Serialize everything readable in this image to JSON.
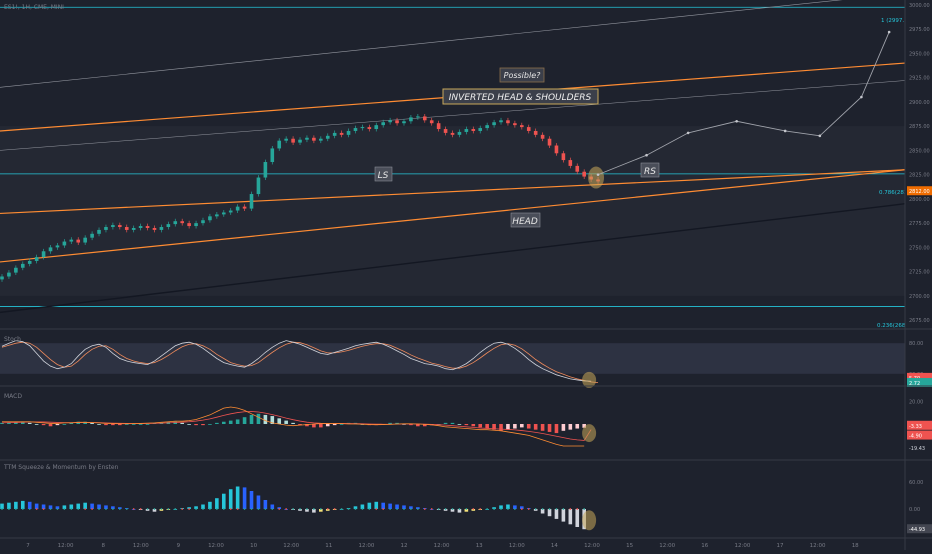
{
  "header": {
    "symbol_line": "ES1!, 1H, CME, MINI"
  },
  "panes": {
    "stoch_title": "Stoch",
    "macd_title": "MACD",
    "ttm_title": "TTM Squeeze & Momentum by Ensten"
  },
  "annotations": {
    "possible": "Possible?",
    "pattern": "INVERTED HEAD & SHOULDERS",
    "ls": "LS",
    "head": "HEAD",
    "rs": "RS"
  },
  "levels": {
    "top_label": "1 (2997.50)",
    "fib_label": "0.786(2825.75)",
    "bottom_label": "0.236(2689.00)"
  },
  "axis": {
    "price_ticks": [
      "3000.00",
      "2975.00",
      "2950.00",
      "2925.00",
      "2900.00",
      "2875.00",
      "2850.00",
      "2825.00",
      "2800.00",
      "2775.00",
      "2750.00",
      "2725.00",
      "2700.00",
      "2675.00"
    ],
    "current_price": "2812.00",
    "stoch_ticks": [
      "80.00",
      "20.00"
    ],
    "stoch_values": [
      "5.70",
      "2.72"
    ],
    "macd_ticks": [
      "20.00",
      "0.00"
    ],
    "macd_values": [
      "-3.33",
      "-4.90",
      "-19.43"
    ],
    "ttm_ticks": [
      "60.00",
      "0.00"
    ],
    "ttm_value": "-44.93",
    "time_labels": [
      "7",
      "12:00",
      "8",
      "12:00",
      "9",
      "12:00",
      "10",
      "12:00",
      "11",
      "12:00",
      "12",
      "12:00",
      "13",
      "12:00",
      "14",
      "12:00",
      "15",
      "12:00",
      "16",
      "12:00",
      "17",
      "12:00",
      "18"
    ]
  },
  "colors": {
    "background": "#1e222d",
    "band": "#2a2e39",
    "up": "#26a69a",
    "down": "#ef5350",
    "orange": "#ff8c33",
    "teal_line": "#26c6da",
    "highlight": "#c8a85a"
  },
  "chart_data": {
    "type": "candlestick",
    "price_series": {
      "name": "ES1!",
      "close": [
        2720,
        2724,
        2729,
        2733,
        2736,
        2740,
        2746,
        2750,
        2752,
        2756,
        2758,
        2755,
        2760,
        2764,
        2768,
        2771,
        2773,
        2771,
        2768,
        2770,
        2772,
        2770,
        2768,
        2771,
        2774,
        2777,
        2775,
        2772,
        2775,
        2778,
        2782,
        2784,
        2786,
        2788,
        2792,
        2790,
        2805,
        2822,
        2838,
        2852,
        2860,
        2862,
        2858,
        2861,
        2863,
        2860,
        2862,
        2865,
        2868,
        2866,
        2870,
        2873,
        2874,
        2872,
        2876,
        2879,
        2881,
        2878,
        2880,
        2884,
        2885,
        2881,
        2878,
        2872,
        2868,
        2866,
        2869,
        2872,
        2870,
        2873,
        2876,
        2879,
        2881,
        2878,
        2876,
        2874,
        2870,
        2866,
        2862,
        2855,
        2847,
        2840,
        2834,
        2828,
        2823,
        2820,
        2818
      ],
      "lows_note_removed": null
    },
    "projection_path": {
      "name": "Possible?",
      "bar_index": [
        86,
        93,
        99,
        106,
        113,
        118,
        124,
        128
      ],
      "price": [
        2825,
        2845,
        2868,
        2880,
        2870,
        2865,
        2905,
        2972
      ]
    },
    "horizontal_levels": [
      2997.5,
      2825.75,
      2689
    ],
    "price_range": [
      2670,
      3005
    ],
    "stoch_pane": {
      "range": [
        0,
        100
      ],
      "band": [
        20,
        80
      ],
      "k": [
        74,
        80,
        85,
        83,
        75,
        60,
        45,
        35,
        30,
        33,
        40,
        55,
        68,
        75,
        78,
        72,
        60,
        50,
        45,
        42,
        40,
        38,
        45,
        55,
        65,
        75,
        80,
        82,
        78,
        70,
        60,
        50,
        42,
        38,
        35,
        33,
        40,
        50,
        62,
        72,
        80,
        85,
        82,
        78,
        72,
        66,
        60,
        58,
        62,
        66,
        70,
        75,
        78,
        80,
        82,
        78,
        72,
        65,
        58,
        50,
        45,
        40,
        38,
        35,
        30,
        28,
        33,
        40,
        50,
        62,
        72,
        80,
        82,
        78,
        70,
        60,
        48,
        38,
        30,
        24,
        18,
        14,
        10,
        8,
        6,
        5.7
      ],
      "d": [
        72,
        76,
        80,
        82,
        80,
        72,
        60,
        48,
        38,
        33,
        35,
        45,
        58,
        68,
        74,
        75,
        68,
        58,
        50,
        45,
        42,
        40,
        42,
        48,
        56,
        65,
        73,
        78,
        79,
        75,
        68,
        58,
        50,
        42,
        38,
        35,
        36,
        42,
        52,
        62,
        71,
        78,
        82,
        81,
        77,
        71,
        65,
        61,
        61,
        63,
        66,
        70,
        74,
        77,
        79,
        79,
        76,
        70,
        64,
        57,
        51,
        46,
        41,
        38,
        34,
        31,
        31,
        35,
        42,
        51,
        61,
        70,
        77,
        79,
        76,
        69,
        59,
        48,
        39,
        31,
        24,
        19,
        14,
        10,
        7,
        4,
        2.72
      ]
    },
    "macd_pane": {
      "range": [
        -30,
        30
      ],
      "histogram": [
        1,
        1.5,
        2,
        2,
        1,
        0,
        -1,
        -2,
        -1,
        0,
        1,
        2,
        2,
        1,
        0,
        -1,
        -1,
        -1,
        0,
        0,
        0,
        0,
        1,
        1,
        2,
        2,
        1,
        0,
        -1,
        -1,
        0,
        1,
        2,
        3,
        4,
        6,
        8,
        9,
        8,
        7,
        5,
        3,
        1,
        -1,
        -2,
        -3,
        -3,
        -2,
        -1,
        0,
        1,
        1,
        0,
        -1,
        -1,
        0,
        1,
        1,
        0,
        -1,
        -2,
        -2,
        -1,
        0,
        1,
        1,
        0,
        -1,
        -2,
        -3,
        -4,
        -5,
        -6,
        -5,
        -4,
        -3,
        -4,
        -5,
        -6,
        -7,
        -8,
        -6,
        -5,
        -4,
        -3.33
      ],
      "macd": [
        2,
        2,
        2,
        2,
        2,
        1.5,
        1,
        0.5,
        0.5,
        1,
        1,
        1.5,
        1.5,
        1.2,
        1,
        0.5,
        0.3,
        0.2,
        0.2,
        0.3,
        0.5,
        0.8,
        1,
        1.5,
        2,
        2.5,
        2.5,
        3,
        4,
        6,
        8,
        11,
        14,
        15,
        14,
        12,
        9,
        6,
        3,
        1,
        0,
        -1,
        -1.5,
        -1,
        -0.5,
        0,
        0.3,
        0.5,
        0.5,
        0.3,
        0,
        0,
        -0.2,
        -0.5,
        -0.6,
        -0.5,
        -0.3,
        0,
        0.2,
        0.2,
        0,
        -0.3,
        -0.8,
        -1.5,
        -2.5,
        -3,
        -3.5,
        -4,
        -4.5,
        -5,
        -5,
        -5.5,
        -6,
        -7,
        -8,
        -9,
        -10,
        -12,
        -14,
        -16,
        -18,
        -19.43,
        -19.43,
        -19.43,
        -19.43
      ],
      "signal": [
        1,
        1.2,
        1.4,
        1.6,
        1.8,
        1.9,
        1.8,
        1.6,
        1.4,
        1.2,
        1.2,
        1.2,
        1.3,
        1.3,
        1.2,
        1,
        0.8,
        0.6,
        0.5,
        0.4,
        0.4,
        0.5,
        0.6,
        0.8,
        1,
        1.3,
        1.6,
        2,
        2.6,
        3.4,
        4.5,
        6,
        7.6,
        9,
        10.1,
        10.8,
        11,
        10.6,
        9.6,
        8.3,
        6.8,
        5.2,
        3.8,
        2.6,
        1.6,
        1,
        0.6,
        0.5,
        0.5,
        0.5,
        0.4,
        0.3,
        0.2,
        0,
        -0.1,
        -0.2,
        -0.2,
        -0.1,
        0,
        0,
        0,
        -0.1,
        -0.3,
        -0.6,
        -1,
        -1.5,
        -2,
        -2.5,
        -3,
        -3.5,
        -3.9,
        -4.2,
        -4.5,
        -4.8,
        -5.2,
        -5.8,
        -6.5,
        -7.4,
        -8.4,
        -9.6,
        -10.8,
        -12,
        -13.2,
        -14,
        -14.5,
        -4.9
      ],
      "histogram_last": -3.33,
      "signal_last": -4.9,
      "macd_last": -19.43
    },
    "ttm_pane": {
      "range": [
        -60,
        100
      ],
      "momentum": [
        12,
        14,
        16,
        18,
        16,
        12,
        10,
        8,
        6,
        8,
        10,
        12,
        14,
        12,
        10,
        8,
        6,
        4,
        2,
        0,
        -2,
        -4,
        -6,
        -4,
        -2,
        0,
        2,
        4,
        6,
        10,
        16,
        24,
        34,
        44,
        50,
        48,
        40,
        30,
        20,
        10,
        4,
        0,
        -2,
        -4,
        -6,
        -8,
        -6,
        -4,
        -2,
        0,
        2,
        6,
        10,
        14,
        16,
        14,
        12,
        10,
        8,
        6,
        4,
        2,
        0,
        -2,
        -4,
        -6,
        -8,
        -6,
        -4,
        -2,
        0,
        4,
        8,
        10,
        8,
        6,
        2,
        -4,
        -10,
        -16,
        -22,
        -28,
        -34,
        -40,
        -44.93
      ],
      "last": -44.93
    }
  }
}
